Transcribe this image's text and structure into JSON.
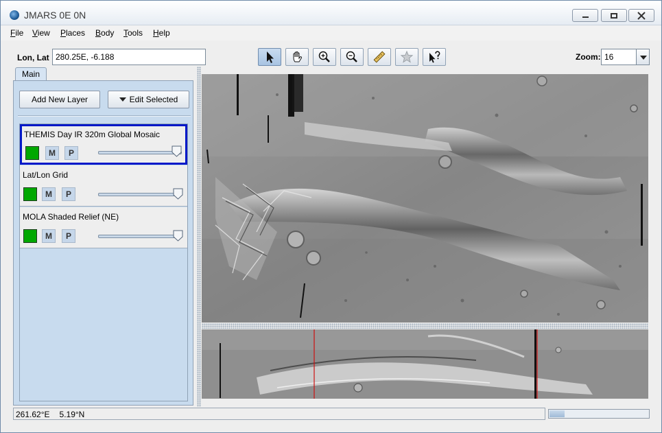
{
  "window": {
    "title": "JMARS 0E 0N"
  },
  "menu": [
    "File",
    "View",
    "Places",
    "Body",
    "Tools",
    "Help"
  ],
  "toolbar": {
    "lonlat_label": "Lon, Lat",
    "lonlat_value": "280.25E, -6.188",
    "tools": [
      "select-arrow-icon",
      "pan-hand-icon",
      "zoom-in-icon",
      "zoom-out-icon",
      "measure-ruler-icon",
      "favorite-star-icon",
      "investigate-icon"
    ],
    "selected_tool": "select-arrow-icon",
    "zoom_label": "Zoom:",
    "zoom_value": "16"
  },
  "panel": {
    "tab": "Main",
    "add_layer": "Add New Layer",
    "edit_selected": "Edit Selected",
    "layers": [
      {
        "name": "THEMIS Day IR 320m Global Mosaic",
        "selected": true,
        "m": "M",
        "p": "P",
        "opacity": 1.0
      },
      {
        "name": "Lat/Lon Grid",
        "selected": false,
        "m": "M",
        "p": "P",
        "opacity": 1.0
      },
      {
        "name": "MOLA Shaded Relief (NE)",
        "selected": false,
        "m": "M",
        "p": "P",
        "opacity": 1.0
      }
    ]
  },
  "status": {
    "lon": "261.62°E",
    "lat": "5.19°N",
    "progress": 0.15
  },
  "colors": {
    "layer_visible": "#00a800",
    "selected_border": "#0018c8",
    "grid_line": "#cc1111"
  }
}
